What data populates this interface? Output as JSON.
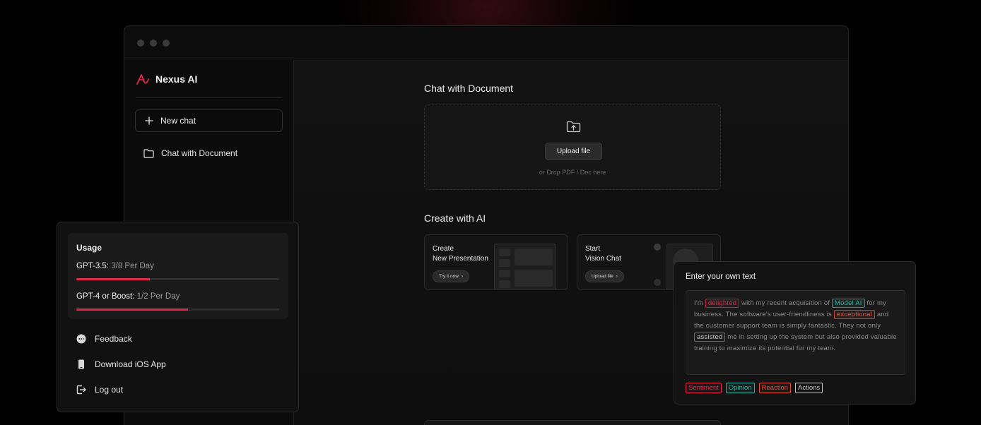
{
  "app": {
    "name": "Nexus AI"
  },
  "sidebar": {
    "new_chat": "New chat",
    "items": [
      {
        "label": "Chat with Document"
      }
    ]
  },
  "main": {
    "chat_doc_heading": "Chat with Document",
    "upload_button": "Upload file",
    "upload_hint": "or Drop PDF / Doc here",
    "create_heading": "Create with AI",
    "cards": [
      {
        "title_line1": "Create",
        "title_line2": "New Presentation",
        "button": "Try it now"
      },
      {
        "title_line1": "Start",
        "title_line2": "Vision Chat",
        "button": "Upload file"
      }
    ]
  },
  "usage": {
    "title": "Usage",
    "rows": [
      {
        "label": "GPT-3.5:",
        "value": "3/8 Per Day",
        "fraction": 0.3625
      },
      {
        "label": "GPT-4 or Boost:",
        "value": "1/2 Per Day",
        "fraction": 0.55
      }
    ],
    "menu": [
      {
        "label": "Feedback",
        "icon": "chat-bubble-icon"
      },
      {
        "label": "Download iOS App",
        "icon": "phone-icon"
      },
      {
        "label": "Log out",
        "icon": "logout-icon"
      }
    ]
  },
  "text_panel": {
    "title": "Enter your own text",
    "segments": [
      {
        "text": "I'm "
      },
      {
        "text": "delighted",
        "tag": "red"
      },
      {
        "text": " with my recent acquisition of "
      },
      {
        "text": "Model AI",
        "tag": "teal"
      },
      {
        "text": " for my business. The software's user-friendliness is "
      },
      {
        "text": "exceptional",
        "tag": "orange"
      },
      {
        "text": " and the customer support team is simply fantastic. They not only "
      },
      {
        "text": "assisted",
        "tag": "gray"
      },
      {
        "text": " me in setting up the system but also provided valuable training to maximize its potential for my team."
      }
    ],
    "chips": [
      {
        "label": "Sentiment",
        "tag": "red"
      },
      {
        "label": "Opinion",
        "tag": "teal"
      },
      {
        "label": "Reaction",
        "tag": "orange"
      },
      {
        "label": "Actions",
        "tag": "gray"
      }
    ]
  },
  "colors": {
    "accent": "#e2294a",
    "teal": "#2ab3a3",
    "orange": "#e2513a"
  }
}
